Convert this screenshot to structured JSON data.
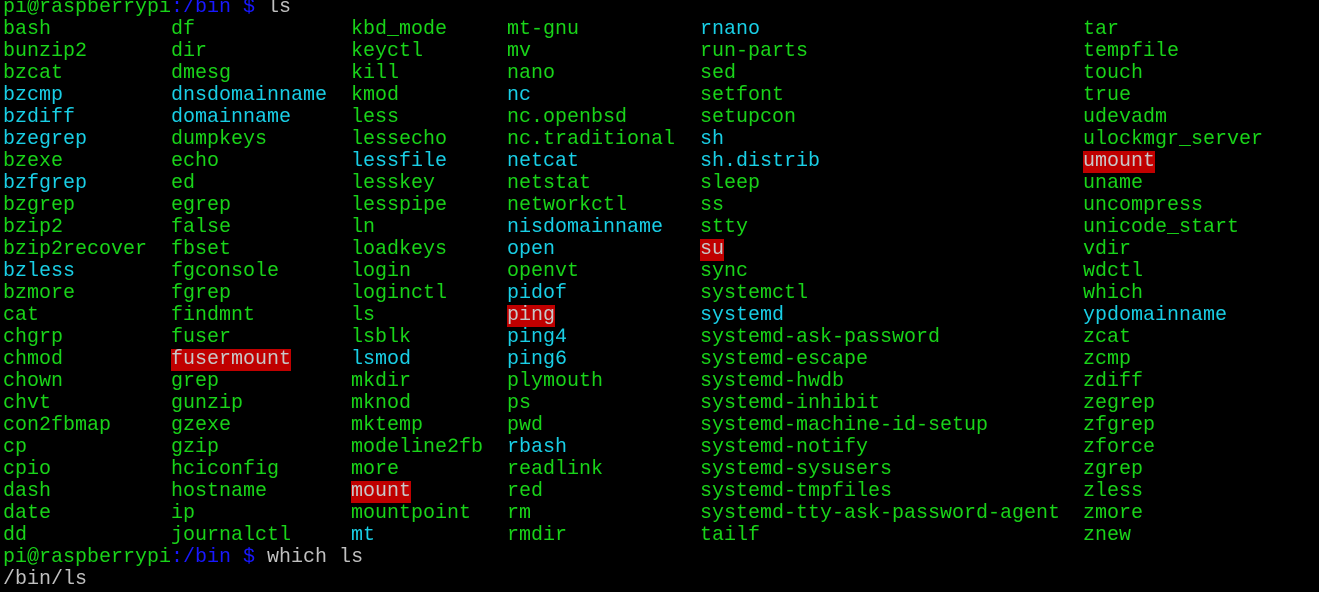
{
  "colors": {
    "executable": "#19d419",
    "symlink": "#19cfe6",
    "setuid_bg": "#c00000",
    "setuid_fg": "#c8c8c8",
    "prompt_user": "#19d419",
    "prompt_path": "#1818ff",
    "text": "#c0c0c0",
    "background": "#000000"
  },
  "prompt1": {
    "user": "pi@raspberrypi",
    "path": ":/bin $",
    "command": " ls"
  },
  "prompt2": {
    "user": "pi@raspberrypi",
    "path": ":/bin $",
    "command": " which ls"
  },
  "output": "/bin/ls",
  "columns": [
    [
      "bash",
      "bunzip2",
      "bzcat",
      "bzcmp",
      "bzdiff",
      "bzegrep",
      "bzexe",
      "bzfgrep",
      "bzgrep",
      "bzip2",
      "bzip2recover",
      "bzless",
      "bzmore",
      "cat",
      "chgrp",
      "chmod",
      "chown",
      "chvt",
      "con2fbmap",
      "cp",
      "cpio",
      "dash",
      "date",
      "dd"
    ],
    [
      "df",
      "dir",
      "dmesg",
      "dnsdomainname",
      "domainname",
      "dumpkeys",
      "echo",
      "ed",
      "egrep",
      "false",
      "fbset",
      "fgconsole",
      "fgrep",
      "findmnt",
      "fuser",
      "fusermount",
      "grep",
      "gunzip",
      "gzexe",
      "gzip",
      "hciconfig",
      "hostname",
      "ip",
      "journalctl"
    ],
    [
      "kbd_mode",
      "keyctl",
      "kill",
      "kmod",
      "less",
      "lessecho",
      "lessfile",
      "lesskey",
      "lesspipe",
      "ln",
      "loadkeys",
      "login",
      "loginctl",
      "ls",
      "lsblk",
      "lsmod",
      "mkdir",
      "mknod",
      "mktemp",
      "modeline2fb",
      "more",
      "mount",
      "mountpoint",
      "mt"
    ],
    [
      "mt-gnu",
      "mv",
      "nano",
      "nc",
      "nc.openbsd",
      "nc.traditional",
      "netcat",
      "netstat",
      "networkctl",
      "nisdomainname",
      "open",
      "openvt",
      "pidof",
      "ping",
      "ping4",
      "ping6",
      "plymouth",
      "ps",
      "pwd",
      "rbash",
      "readlink",
      "red",
      "rm",
      "rmdir"
    ],
    [
      "rnano",
      "run-parts",
      "sed",
      "setfont",
      "setupcon",
      "sh",
      "sh.distrib",
      "sleep",
      "ss",
      "stty",
      "su",
      "sync",
      "systemctl",
      "systemd",
      "systemd-ask-password",
      "systemd-escape",
      "systemd-hwdb",
      "systemd-inhibit",
      "systemd-machine-id-setup",
      "systemd-notify",
      "systemd-sysusers",
      "systemd-tmpfiles",
      "systemd-tty-ask-password-agent",
      "tailf"
    ],
    [
      "tar",
      "tempfile",
      "touch",
      "true",
      "udevadm",
      "ulockmgr_server",
      "umount",
      "uname",
      "uncompress",
      "unicode_start",
      "vdir",
      "wdctl",
      "which",
      "ypdomainname",
      "zcat",
      "zcmp",
      "zdiff",
      "zegrep",
      "zfgrep",
      "zforce",
      "zgrep",
      "zless",
      "zmore",
      "znew"
    ]
  ],
  "symlinks": [
    "bzcmp",
    "bzdiff",
    "bzegrep",
    "bzfgrep",
    "bzless",
    "dnsdomainname",
    "domainname",
    "lessfile",
    "lsmod",
    "mt",
    "nc",
    "netcat",
    "nisdomainname",
    "open",
    "pidof",
    "ping4",
    "ping6",
    "rbash",
    "rnano",
    "sh",
    "sh.distrib",
    "systemd",
    "ypdomainname"
  ],
  "setuid": [
    "fusermount",
    "mount",
    "ping",
    "su",
    "umount"
  ]
}
